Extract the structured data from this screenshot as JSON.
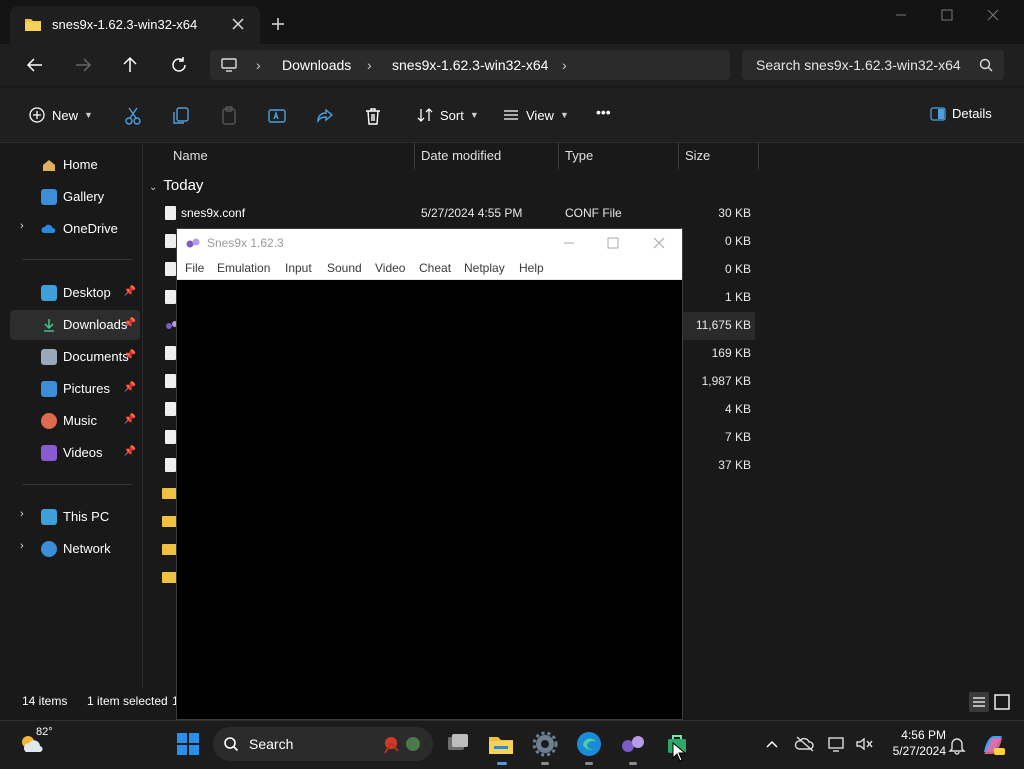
{
  "explorer": {
    "tab_title": "snes9x-1.62.3-win32-x64",
    "breadcrumb": [
      "Downloads",
      "snes9x-1.62.3-win32-x64"
    ],
    "search_placeholder": "Search snes9x-1.62.3-win32-x64",
    "commands": {
      "new": "New",
      "sort": "Sort",
      "view": "View",
      "more": "•••",
      "details": "Details"
    },
    "nav": {
      "home": "Home",
      "gallery": "Gallery",
      "onedrive": "OneDrive",
      "desktop": "Desktop",
      "downloads": "Downloads",
      "documents": "Documents",
      "pictures": "Pictures",
      "music": "Music",
      "videos": "Videos",
      "thispc": "This PC",
      "network": "Network"
    },
    "columns": {
      "name": "Name",
      "date": "Date modified",
      "type": "Type",
      "size": "Size"
    },
    "group": "Today",
    "files": [
      {
        "name": "snes9x.conf",
        "date": "5/27/2024 4:55 PM",
        "type": "CONF File",
        "size": "30 KB"
      },
      {
        "name": "",
        "date": "",
        "type": "",
        "size": "0 KB"
      },
      {
        "name": "",
        "date": "",
        "type": "",
        "size": "0 KB"
      },
      {
        "name": "",
        "date": "",
        "type": "",
        "size": "1 KB"
      },
      {
        "name": "",
        "date": "",
        "type": "",
        "size": "11,675 KB"
      },
      {
        "name": "",
        "date": "",
        "type": "",
        "size": "169 KB"
      },
      {
        "name": "",
        "date": "",
        "type": "",
        "size": "1,987 KB"
      },
      {
        "name": "",
        "date": "",
        "type": "",
        "size": "4 KB"
      },
      {
        "name": "",
        "date": "",
        "type": "",
        "size": "7 KB"
      },
      {
        "name": "",
        "date": "",
        "type": "",
        "size": "37 KB"
      }
    ],
    "status": {
      "items": "14 items",
      "selected": "1 item selected",
      "partial": "1"
    }
  },
  "snes9x": {
    "title": "Snes9x 1.62.3",
    "menu": [
      "File",
      "Emulation",
      "Input",
      "Sound",
      "Video",
      "Cheat",
      "Netplay",
      "Help"
    ]
  },
  "taskbar": {
    "weather": "82°",
    "search_label": "Search",
    "time": "4:56 PM",
    "date": "5/27/2024"
  },
  "colors": {
    "accent": "#0078d4",
    "folder": "#f0c040",
    "snes_purple": "#7b5cc4"
  }
}
